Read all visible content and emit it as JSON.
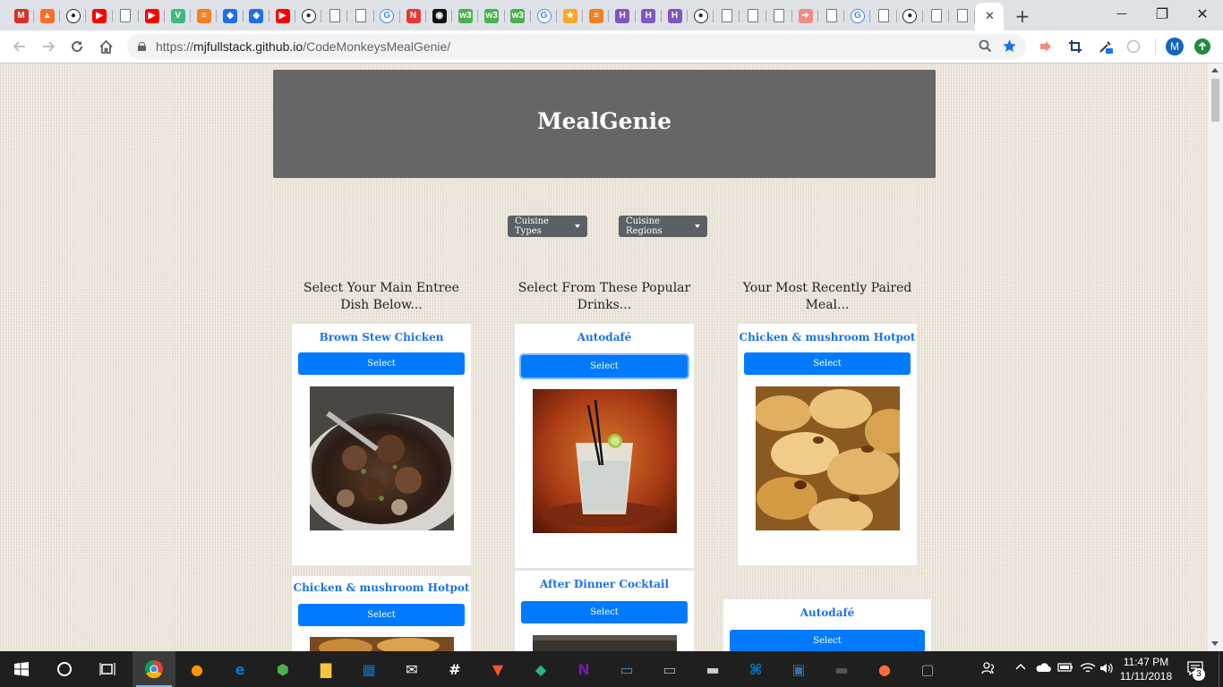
{
  "browser": {
    "tabs": [
      {
        "icon": "gmail-icon",
        "color": "#d93025",
        "glyph": "M"
      },
      {
        "icon": "gitlab-icon",
        "color": "#fc6d26",
        "glyph": "▲"
      },
      {
        "icon": "github-icon",
        "color": "#24292e",
        "glyph": "●"
      },
      {
        "icon": "youtube-icon",
        "color": "#ff0000",
        "glyph": "▶"
      },
      {
        "icon": "blank-page-icon",
        "color": "#ffffff",
        "glyph": ""
      },
      {
        "icon": "youtube-icon",
        "color": "#ff0000",
        "glyph": "▶"
      },
      {
        "icon": "vue-icon",
        "color": "#41b883",
        "glyph": "V"
      },
      {
        "icon": "stackoverflow-icon",
        "color": "#f48024",
        "glyph": "≡"
      },
      {
        "icon": "cube-icon",
        "color": "#1f6feb",
        "glyph": "◆"
      },
      {
        "icon": "cube-icon",
        "color": "#1f6feb",
        "glyph": "◆"
      },
      {
        "icon": "youtube-icon",
        "color": "#ff0000",
        "glyph": "▶"
      },
      {
        "icon": "github-icon",
        "color": "#24292e",
        "glyph": "●"
      },
      {
        "icon": "blank-page-icon",
        "color": "#ffffff",
        "glyph": ""
      },
      {
        "icon": "blank-page-icon",
        "color": "#ffffff",
        "glyph": ""
      },
      {
        "icon": "google-icon",
        "color": "#4285f4",
        "glyph": "G"
      },
      {
        "icon": "n-app-icon",
        "color": "#e53935",
        "glyph": "N"
      },
      {
        "icon": "circle-app-icon",
        "color": "#111111",
        "glyph": "◉"
      },
      {
        "icon": "w3schools-icon",
        "color": "#4caf50",
        "glyph": "w3"
      },
      {
        "icon": "w3schools-icon",
        "color": "#4caf50",
        "glyph": "w3"
      },
      {
        "icon": "w3schools-icon",
        "color": "#4caf50",
        "glyph": "w3"
      },
      {
        "icon": "google-icon",
        "color": "#4285f4",
        "glyph": "G"
      },
      {
        "icon": "app-icon",
        "color": "#f9a825",
        "glyph": "★"
      },
      {
        "icon": "stackoverflow-icon",
        "color": "#f48024",
        "glyph": "≡"
      },
      {
        "icon": "heroku-icon",
        "color": "#7e57c2",
        "glyph": "H"
      },
      {
        "icon": "heroku-icon",
        "color": "#7e57c2",
        "glyph": "H"
      },
      {
        "icon": "heroku-icon",
        "color": "#7e57c2",
        "glyph": "H"
      },
      {
        "icon": "github-icon",
        "color": "#24292e",
        "glyph": "●"
      },
      {
        "icon": "blank-page-icon",
        "color": "#ffffff",
        "glyph": ""
      },
      {
        "icon": "blank-page-icon",
        "color": "#ffffff",
        "glyph": ""
      },
      {
        "icon": "blank-page-icon",
        "color": "#ffffff",
        "glyph": ""
      },
      {
        "icon": "arrow-app-icon",
        "color": "#f28b82",
        "glyph": "➜"
      },
      {
        "icon": "blank-page-icon",
        "color": "#ffffff",
        "glyph": ""
      },
      {
        "icon": "google-icon",
        "color": "#4285f4",
        "glyph": "G"
      },
      {
        "icon": "blank-page-icon",
        "color": "#ffffff",
        "glyph": ""
      },
      {
        "icon": "github-icon",
        "color": "#24292e",
        "glyph": "●"
      },
      {
        "icon": "blank-page-icon",
        "color": "#ffffff",
        "glyph": ""
      },
      {
        "icon": "blank-page-icon",
        "color": "#ffffff",
        "glyph": ""
      }
    ],
    "active_tab_close": "✕",
    "new_tab": "+",
    "url_scheme": "https://",
    "url_host": "mjfullstack.github.io",
    "url_path": "/CodeMonkeysMealGenie/",
    "profile_initial": "M"
  },
  "page": {
    "title": "MealGenie",
    "dropdowns": {
      "cuisine_types": "Cuisine Types",
      "cuisine_regions": "Cuisine Regions"
    },
    "columns": {
      "entrees_heading": "Select Your Main Entree Dish Below...",
      "drinks_heading": "Select From These Popular Drinks...",
      "recent_heading": "Your Most Recently Paired Meal..."
    },
    "select_label": "Select",
    "entrees": [
      {
        "name": "Brown Stew Chicken"
      },
      {
        "name": "Chicken & mushroom Hotpot"
      }
    ],
    "drinks": [
      {
        "name": "Autodafé"
      },
      {
        "name": "After Dinner Cocktail"
      }
    ],
    "recent": [
      {
        "name": "Chicken & mushroom Hotpot"
      },
      {
        "name": "Autodafé"
      }
    ]
  },
  "taskbar": {
    "time": "11:47 PM",
    "date": "11/11/2018",
    "notification_count": "3",
    "apps": [
      {
        "icon": "chrome-icon",
        "running": true,
        "active": true
      },
      {
        "icon": "firefox-icon",
        "running": false
      },
      {
        "icon": "edge-icon",
        "running": false
      },
      {
        "icon": "shield-app-icon",
        "running": false
      },
      {
        "icon": "file-explorer-icon",
        "running": false
      },
      {
        "icon": "store-icon",
        "running": false
      },
      {
        "icon": "mail-icon",
        "running": false
      },
      {
        "icon": "slack-icon",
        "running": false
      },
      {
        "icon": "brave-icon",
        "running": false
      },
      {
        "icon": "gitkraken-icon",
        "running": false
      },
      {
        "icon": "onenote-icon",
        "running": false
      },
      {
        "icon": "remote-desktop-icon",
        "running": false
      },
      {
        "icon": "photos-icon",
        "running": false
      },
      {
        "icon": "terminal-icon",
        "running": false
      },
      {
        "icon": "vscode-icon",
        "running": false
      },
      {
        "icon": "mysql-workbench-icon",
        "running": false
      },
      {
        "icon": "mysql-cli-icon",
        "running": false
      },
      {
        "icon": "postman-icon",
        "running": false
      },
      {
        "icon": "app-icon",
        "running": false
      }
    ]
  },
  "colors": {
    "hero_bg": "#666666",
    "primary": "#007bff",
    "card_title": "#1a73e8",
    "dropdown_bg": "#5b6064"
  }
}
